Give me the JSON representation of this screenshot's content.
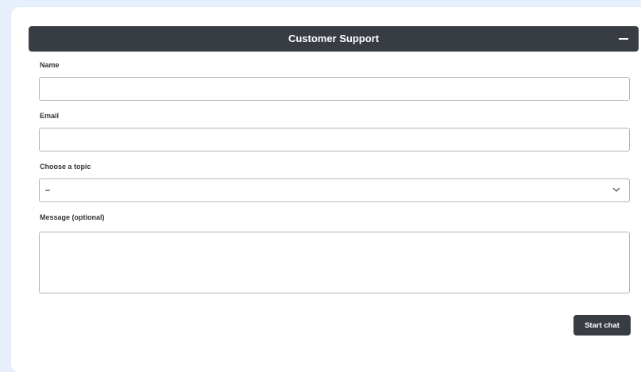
{
  "header": {
    "title": "Customer Support",
    "minimize_icon": "minimize-icon"
  },
  "form": {
    "name_label": "Name",
    "name_value": "",
    "email_label": "Email",
    "email_value": "",
    "topic_label": "Choose a topic",
    "topic_selected": "–",
    "topic_icon": "chevron-down-icon",
    "message_label": "Message (optional)",
    "message_value": ""
  },
  "actions": {
    "start_chat_label": "Start chat"
  },
  "colors": {
    "page_background": "#e6f0fc",
    "header_background": "#383c43",
    "button_background": "#383c43",
    "input_border": "#b5b5b5"
  }
}
